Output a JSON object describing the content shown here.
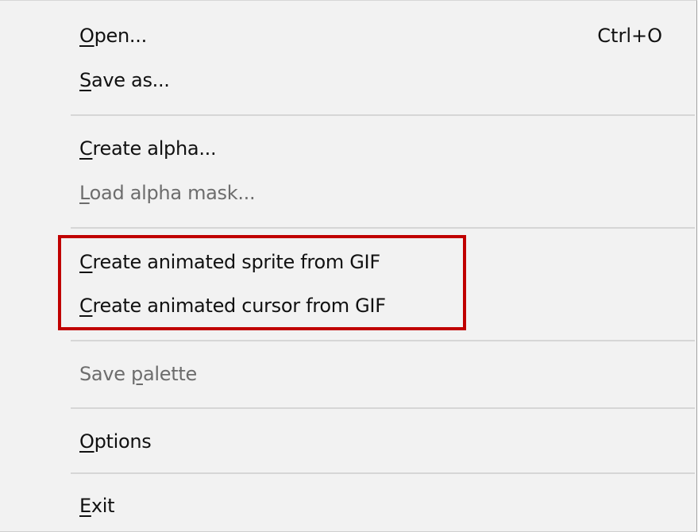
{
  "menu": {
    "items": [
      {
        "pre": "",
        "key": "O",
        "post": "pen...",
        "shortcut": "Ctrl+O",
        "enabled": true
      },
      {
        "pre": "",
        "key": "S",
        "post": "ave as...",
        "shortcut": "",
        "enabled": true
      },
      {
        "pre": "",
        "key": "C",
        "post": "reate alpha...",
        "shortcut": "",
        "enabled": true
      },
      {
        "pre": "",
        "key": "L",
        "post": "oad alpha mask...",
        "shortcut": "",
        "enabled": false
      },
      {
        "pre": "",
        "key": "C",
        "post": "reate animated sprite from GIF",
        "shortcut": "",
        "enabled": true
      },
      {
        "pre": "",
        "key": "C",
        "post": "reate animated cursor from GIF",
        "shortcut": "",
        "enabled": true
      },
      {
        "pre": "Save ",
        "key": "p",
        "post": "alette",
        "shortcut": "",
        "enabled": false
      },
      {
        "pre": "",
        "key": "O",
        "post": "ptions",
        "shortcut": "",
        "enabled": true
      },
      {
        "pre": "",
        "key": "E",
        "post": "xit",
        "shortcut": "",
        "enabled": true
      }
    ]
  },
  "colors": {
    "menu_background": "#f2f2f2",
    "text": "#111111",
    "disabled_text": "#6d6d6d",
    "separator": "#d6d6d6",
    "highlight_box": "#c00000"
  }
}
